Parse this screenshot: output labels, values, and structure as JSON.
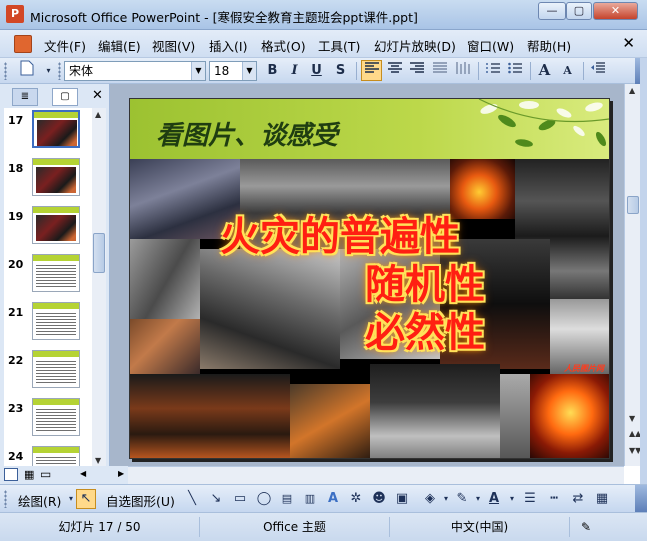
{
  "window": {
    "app_icon": "powerpoint-icon",
    "title": "Microsoft Office PowerPoint - [寒假安全教育主题班会ppt课件.ppt]",
    "minimize_symbol": "—",
    "maximize_symbol": "▢",
    "close_symbol": "✕"
  },
  "menubar": {
    "items": [
      "文件(F)",
      "编辑(E)",
      "视图(V)",
      "插入(I)",
      "格式(O)",
      "工具(T)",
      "幻灯片放映(D)",
      "窗口(W)",
      "帮助(H)"
    ],
    "close_symbol": "✕"
  },
  "format_toolbar": {
    "font_name": "宋体",
    "font_size": "18",
    "bold": "B",
    "italic": "I",
    "underline": "U",
    "shadow": "S",
    "align_left": "≡",
    "align_center": "≡",
    "align_right": "≡",
    "distribute": "⫶",
    "numbering": "⋮≡",
    "bullets": "•≡",
    "increase_font": "A",
    "decrease_font": "A",
    "active_alignment": "left"
  },
  "left_panel": {
    "tab_outline": "≣",
    "tab_slides": "▢",
    "close_symbol": "✕",
    "slides": [
      {
        "number": "17",
        "selected": true,
        "kind": "photo"
      },
      {
        "number": "18",
        "selected": false,
        "kind": "photo"
      },
      {
        "number": "19",
        "selected": false,
        "kind": "photo"
      },
      {
        "number": "20",
        "selected": false,
        "kind": "text"
      },
      {
        "number": "21",
        "selected": false,
        "kind": "text"
      },
      {
        "number": "22",
        "selected": false,
        "kind": "text"
      },
      {
        "number": "23",
        "selected": false,
        "kind": "text"
      },
      {
        "number": "24",
        "selected": false,
        "kind": "text"
      }
    ]
  },
  "slide": {
    "title": "看图片、谈感受",
    "line1": "火灾的普遍性",
    "line2": "随机性",
    "line3": "必然性",
    "watermark": "人民图片网"
  },
  "drawing_toolbar": {
    "draw_label": "绘图(R)",
    "autoshapes_label": "自选图形(U)"
  },
  "statusbar": {
    "slide_info": "幻灯片 17 / 50",
    "theme": "Office 主题",
    "language": "中文(中国)"
  },
  "colors": {
    "title_green": "#1f3d11",
    "header_band": "#b5d334",
    "fire_text": "#ff1f12",
    "fire_glow": "#ffe25a",
    "chrome_blue": "#cfdef2"
  }
}
